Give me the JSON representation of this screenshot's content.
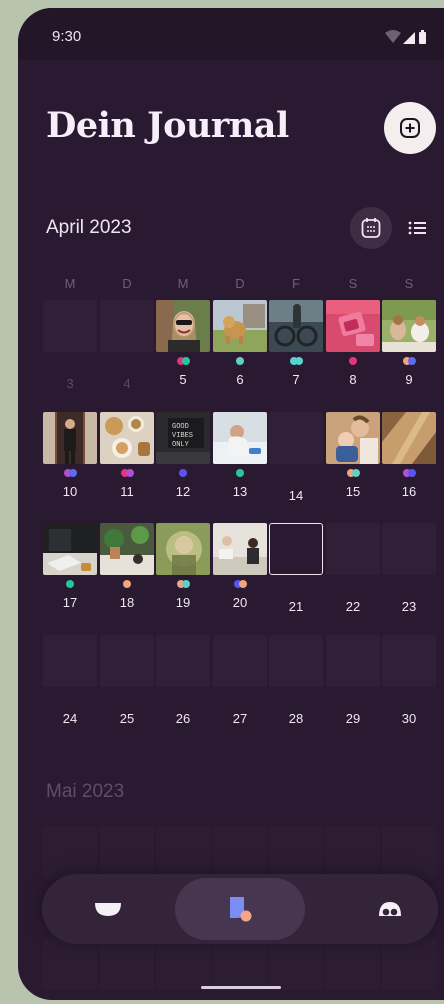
{
  "status_bar": {
    "time": "9:30"
  },
  "header": {
    "title": "Dein Journal",
    "add_icon": "plus-circle-icon"
  },
  "calendar": {
    "month_label": "April 2023",
    "view_toggle": {
      "calendar_icon": "calendar-icon",
      "list_icon": "list-icon"
    },
    "weekdays": [
      "M",
      "D",
      "M",
      "D",
      "F",
      "S",
      "S"
    ],
    "days": [
      {
        "day": "3",
        "dim": true,
        "photo": null,
        "dots": []
      },
      {
        "day": "4",
        "dim": true,
        "photo": null,
        "dots": []
      },
      {
        "day": "5",
        "photo": "woman-sunglasses",
        "dots": [
          "#e8327d",
          "#23c8a0"
        ]
      },
      {
        "day": "6",
        "photo": "dog-grass",
        "dots": [
          "#5fd0c6"
        ]
      },
      {
        "day": "7",
        "photo": "bicycle-scene",
        "dots": [
          "#55d3cf",
          "#55d3cf"
        ]
      },
      {
        "day": "8",
        "photo": "pink-object",
        "dots": [
          "#e8327d"
        ]
      },
      {
        "day": "9",
        "photo": "people-park",
        "dots": [
          "#f2a27c",
          "#5a6cf2"
        ]
      },
      {
        "day": "10",
        "photo": "person-doorway",
        "dots": [
          "#b04fd0",
          "#5a6cf2"
        ]
      },
      {
        "day": "11",
        "photo": "food-table",
        "dots": [
          "#e8327d",
          "#b04fd0"
        ]
      },
      {
        "day": "12",
        "photo": "good-vibes-sign",
        "dots": [
          "#5a55f2"
        ]
      },
      {
        "day": "13",
        "photo": "person-bed",
        "dots": [
          "#23c8a0"
        ]
      },
      {
        "day": "14",
        "photo": null,
        "dots": []
      },
      {
        "day": "15",
        "photo": "baby-adult",
        "dots": [
          "#f2a27c",
          "#5fd0c6"
        ]
      },
      {
        "day": "16",
        "photo": "shadow-light",
        "dots": [
          "#b04fd0",
          "#5a55f2"
        ]
      },
      {
        "day": "17",
        "photo": "laptop-desk",
        "dots": [
          "#23c8a0"
        ]
      },
      {
        "day": "18",
        "photo": "plants-table",
        "dots": [
          "#f2a27c"
        ]
      },
      {
        "day": "19",
        "photo": "blurry-portrait",
        "dots": [
          "#f2a27c",
          "#5fd0c6"
        ]
      },
      {
        "day": "20",
        "photo": "room-person",
        "dots": [
          "#5a55f2",
          "#f2a27c"
        ]
      },
      {
        "day": "21",
        "photo": null,
        "today": true,
        "dots": []
      },
      {
        "day": "22",
        "photo": null,
        "dots": []
      },
      {
        "day": "23",
        "photo": null,
        "dots": []
      },
      {
        "day": "24",
        "photo": null,
        "dots": []
      },
      {
        "day": "25",
        "photo": null,
        "dots": []
      },
      {
        "day": "26",
        "photo": null,
        "dots": []
      },
      {
        "day": "27",
        "photo": null,
        "dots": []
      },
      {
        "day": "28",
        "photo": null,
        "dots": []
      },
      {
        "day": "29",
        "photo": null,
        "dots": []
      },
      {
        "day": "30",
        "photo": null,
        "dots": []
      }
    ],
    "next_month_label": "Mai 2023"
  },
  "bottom_nav": [
    {
      "icon": "half-circle-icon",
      "active": false
    },
    {
      "icon": "journal-shapes-icon",
      "active": true
    },
    {
      "icon": "face-icon",
      "active": false
    }
  ],
  "colors": {
    "background": "#2a1a31",
    "accent_pink": "#e8327d",
    "accent_teal": "#23c8a0",
    "accent_blue": "#5a55f2",
    "accent_peach": "#f2a27c"
  }
}
